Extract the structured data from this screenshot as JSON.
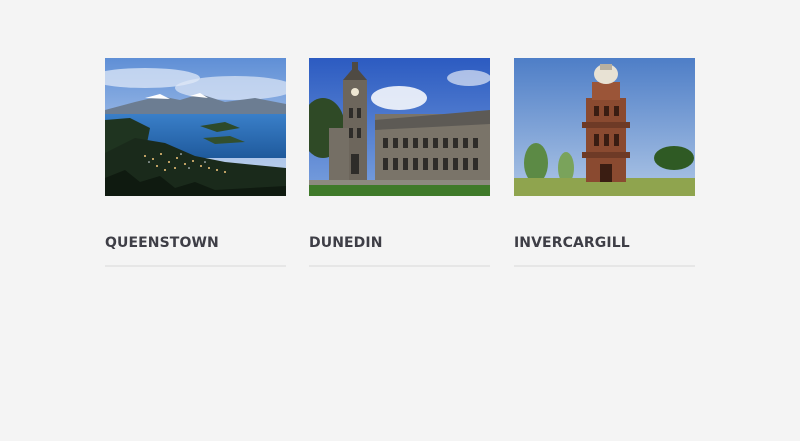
{
  "destinations": [
    {
      "name": "QUEENSTOWN",
      "image": "queenstown-lake-mountains-photo"
    },
    {
      "name": "DUNEDIN",
      "image": "dunedin-university-clocktower-photo"
    },
    {
      "name": "INVERCARGILL",
      "image": "invercargill-water-tower-photo"
    }
  ]
}
